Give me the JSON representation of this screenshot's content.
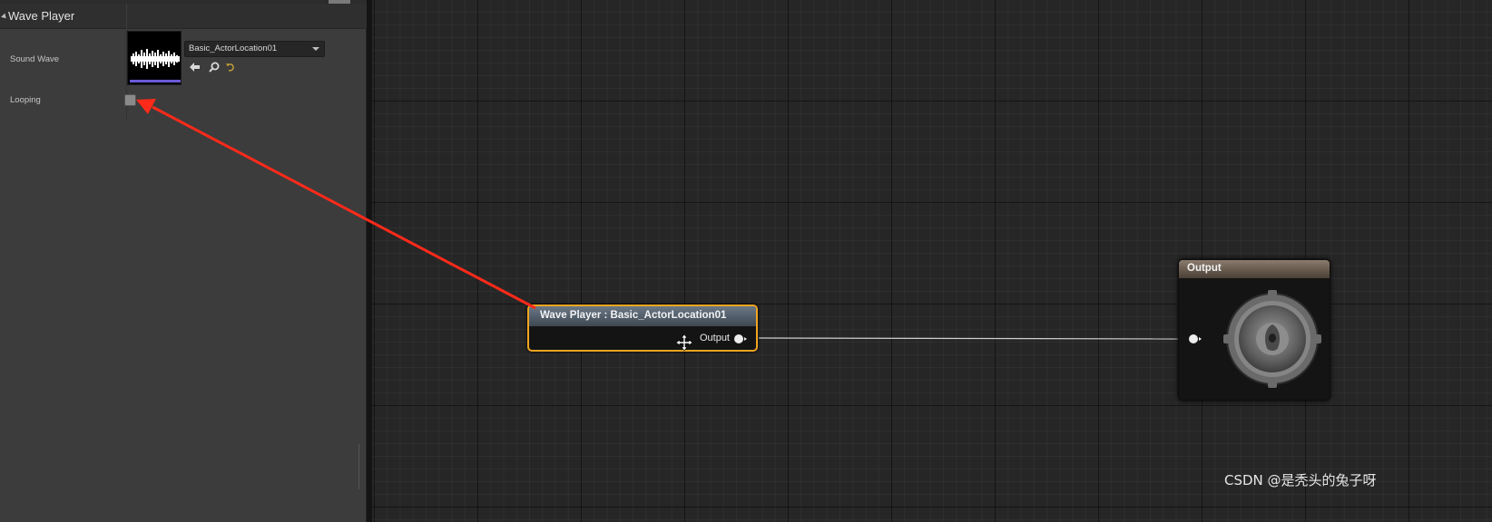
{
  "details": {
    "category_title": "Wave Player",
    "properties": {
      "sound_wave_label": "Sound Wave",
      "sound_wave_value": "Basic_ActorLocation01",
      "looping_label": "Looping",
      "looping_checked": false
    },
    "asset_buttons": [
      "use-selected-icon",
      "browse-icon",
      "reset-icon"
    ]
  },
  "graph": {
    "wave_node": {
      "title": "Wave Player : Basic_ActorLocation01",
      "output_pin_label": "Output",
      "selected": true,
      "border_color": "#f0a521"
    },
    "output_node": {
      "title": "Output",
      "icon": "speaker-icon"
    }
  },
  "annotation": {
    "arrow_color": "#ff2a1a"
  },
  "watermark": "CSDN @是秃头的兔子呀"
}
